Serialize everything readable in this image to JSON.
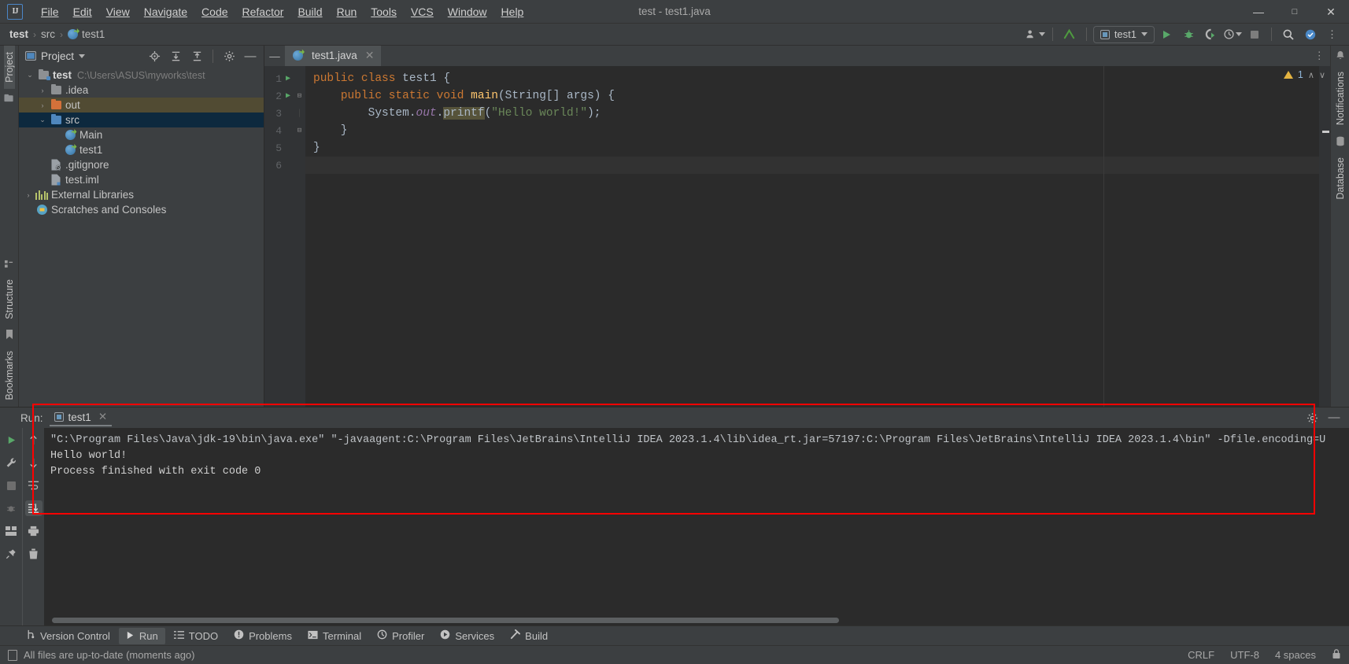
{
  "window": {
    "title": "test - test1.java",
    "logo": "IJ",
    "controls": {
      "minimize": "—",
      "maximize": "❐",
      "close": "✕"
    }
  },
  "menu": [
    {
      "label": "File"
    },
    {
      "label": "Edit"
    },
    {
      "label": "View"
    },
    {
      "label": "Navigate"
    },
    {
      "label": "Code"
    },
    {
      "label": "Refactor"
    },
    {
      "label": "Build"
    },
    {
      "label": "Run"
    },
    {
      "label": "Tools"
    },
    {
      "label": "VCS"
    },
    {
      "label": "Window"
    },
    {
      "label": "Help"
    }
  ],
  "navbar": {
    "breadcrumbs": [
      {
        "label": "test",
        "icon": "none",
        "bold": true
      },
      {
        "label": "src",
        "icon": "none",
        "bold": false
      },
      {
        "label": "test1",
        "icon": "java-class-icon",
        "bold": false
      }
    ],
    "sep": "›",
    "run_config": "test1",
    "icons": [
      "user-avatar-icon",
      "updates-arrow-icon",
      "run-icon",
      "debug-icon",
      "run-coverage-icon",
      "profiler-icon",
      "stop-icon",
      "search-icon",
      "settings-icon",
      "more-icon"
    ]
  },
  "left_rail": {
    "top_label": "Project",
    "icons": [
      "commit-icon"
    ],
    "bottom_labels": [
      "Structure",
      "Bookmarks"
    ]
  },
  "project_panel": {
    "title": "Project",
    "toolbar_icons": [
      "locate-icon",
      "expand-all-icon",
      "collapse-all-icon",
      "settings-gear-icon",
      "hide-icon"
    ],
    "tree": [
      {
        "indent": 0,
        "arrow": "⌄",
        "icon": "module-folder-icon",
        "label": "test",
        "bold": true,
        "path": "C:\\Users\\ASUS\\myworks\\test",
        "state": "none"
      },
      {
        "indent": 1,
        "arrow": "›",
        "icon": "folder-gray-icon",
        "label": ".idea",
        "bold": false,
        "path": "",
        "state": "none"
      },
      {
        "indent": 1,
        "arrow": "›",
        "icon": "folder-orange-icon",
        "label": "out",
        "bold": false,
        "path": "",
        "state": "olive"
      },
      {
        "indent": 1,
        "arrow": "⌄",
        "icon": "folder-blue-icon",
        "label": "src",
        "bold": false,
        "path": "",
        "state": "blue"
      },
      {
        "indent": 2,
        "arrow": "",
        "icon": "java-class-icon",
        "label": "Main",
        "bold": false,
        "path": "",
        "state": "none"
      },
      {
        "indent": 2,
        "arrow": "",
        "icon": "java-class-icon",
        "label": "test1",
        "bold": false,
        "path": "",
        "state": "none"
      },
      {
        "indent": 1,
        "arrow": "",
        "icon": "gitignore-file-icon",
        "label": ".gitignore",
        "bold": false,
        "path": "",
        "state": "none"
      },
      {
        "indent": 1,
        "arrow": "",
        "icon": "iml-file-icon",
        "label": "test.iml",
        "bold": false,
        "path": "",
        "state": "none"
      },
      {
        "indent": 0,
        "arrow": "›",
        "icon": "libraries-icon",
        "label": "External Libraries",
        "bold": false,
        "path": "",
        "state": "none"
      },
      {
        "indent": 0,
        "arrow": "",
        "icon": "scratches-icon",
        "label": "Scratches and Consoles",
        "bold": false,
        "path": "",
        "state": "none"
      }
    ]
  },
  "editor": {
    "tab": {
      "label": "test1.java",
      "icon": "java-class-icon",
      "close": "✕"
    },
    "inspections": {
      "warning_count": "1",
      "up": "∧",
      "down": "∨"
    },
    "lines": [
      {
        "num": "1",
        "run": true,
        "fold": "",
        "text": "public class test1 {"
      },
      {
        "num": "2",
        "run": true,
        "fold": "⊟",
        "text": "    public static void main(String[] args) {"
      },
      {
        "num": "3",
        "run": false,
        "fold": "",
        "text": "        System.out.printf(\"Hello world!\");"
      },
      {
        "num": "4",
        "run": false,
        "fold": "⊟",
        "text": "    }"
      },
      {
        "num": "5",
        "run": false,
        "fold": "",
        "text": "}"
      },
      {
        "num": "6",
        "run": false,
        "fold": "",
        "text": ""
      }
    ]
  },
  "right_rail": {
    "labels": [
      "Notifications",
      "Database"
    ]
  },
  "run_window": {
    "label": "Run:",
    "tab": "test1",
    "tab_close": "✕",
    "toolbar_left_icons": [
      "rerun-icon",
      "wrench-settings-icon",
      "stop-icon",
      "debug-icon",
      "layout-icon",
      "pin-icon"
    ],
    "toolbar_right_icons": [
      "scroll-up-icon",
      "scroll-down-icon",
      "soft-wrap-icon",
      "scroll-to-end-icon",
      "print-icon",
      "clear-all-icon"
    ],
    "header_icons": [
      "settings-gear-icon",
      "minimize-icon"
    ],
    "console": [
      {
        "kind": "cmd",
        "text": "\"C:\\Program Files\\Java\\jdk-19\\bin\\java.exe\" \"-javaagent:C:\\Program Files\\JetBrains\\IntelliJ IDEA 2023.1.4\\lib\\idea_rt.jar=57197:C:\\Program Files\\JetBrains\\IntelliJ IDEA 2023.1.4\\bin\" -Dfile.encoding=U"
      },
      {
        "kind": "out",
        "text": "Hello world!"
      },
      {
        "kind": "out",
        "text": "Process finished with exit code 0"
      }
    ]
  },
  "bottom_toolbar": [
    {
      "label": "Version Control",
      "icon": "branch-icon",
      "active": false
    },
    {
      "label": "Run",
      "icon": "run-icon",
      "active": true
    },
    {
      "label": "TODO",
      "icon": "list-icon",
      "active": false
    },
    {
      "label": "Problems",
      "icon": "problems-icon",
      "active": false
    },
    {
      "label": "Terminal",
      "icon": "terminal-icon",
      "active": false
    },
    {
      "label": "Profiler",
      "icon": "profiler-icon",
      "active": false
    },
    {
      "label": "Services",
      "icon": "services-icon",
      "active": false
    },
    {
      "label": "Build",
      "icon": "build-hammer-icon",
      "active": false
    }
  ],
  "statusbar": {
    "message": "All files are up-to-date (moments ago)",
    "line_sep": "CRLF",
    "encoding": "UTF-8",
    "indent": "4 spaces"
  }
}
